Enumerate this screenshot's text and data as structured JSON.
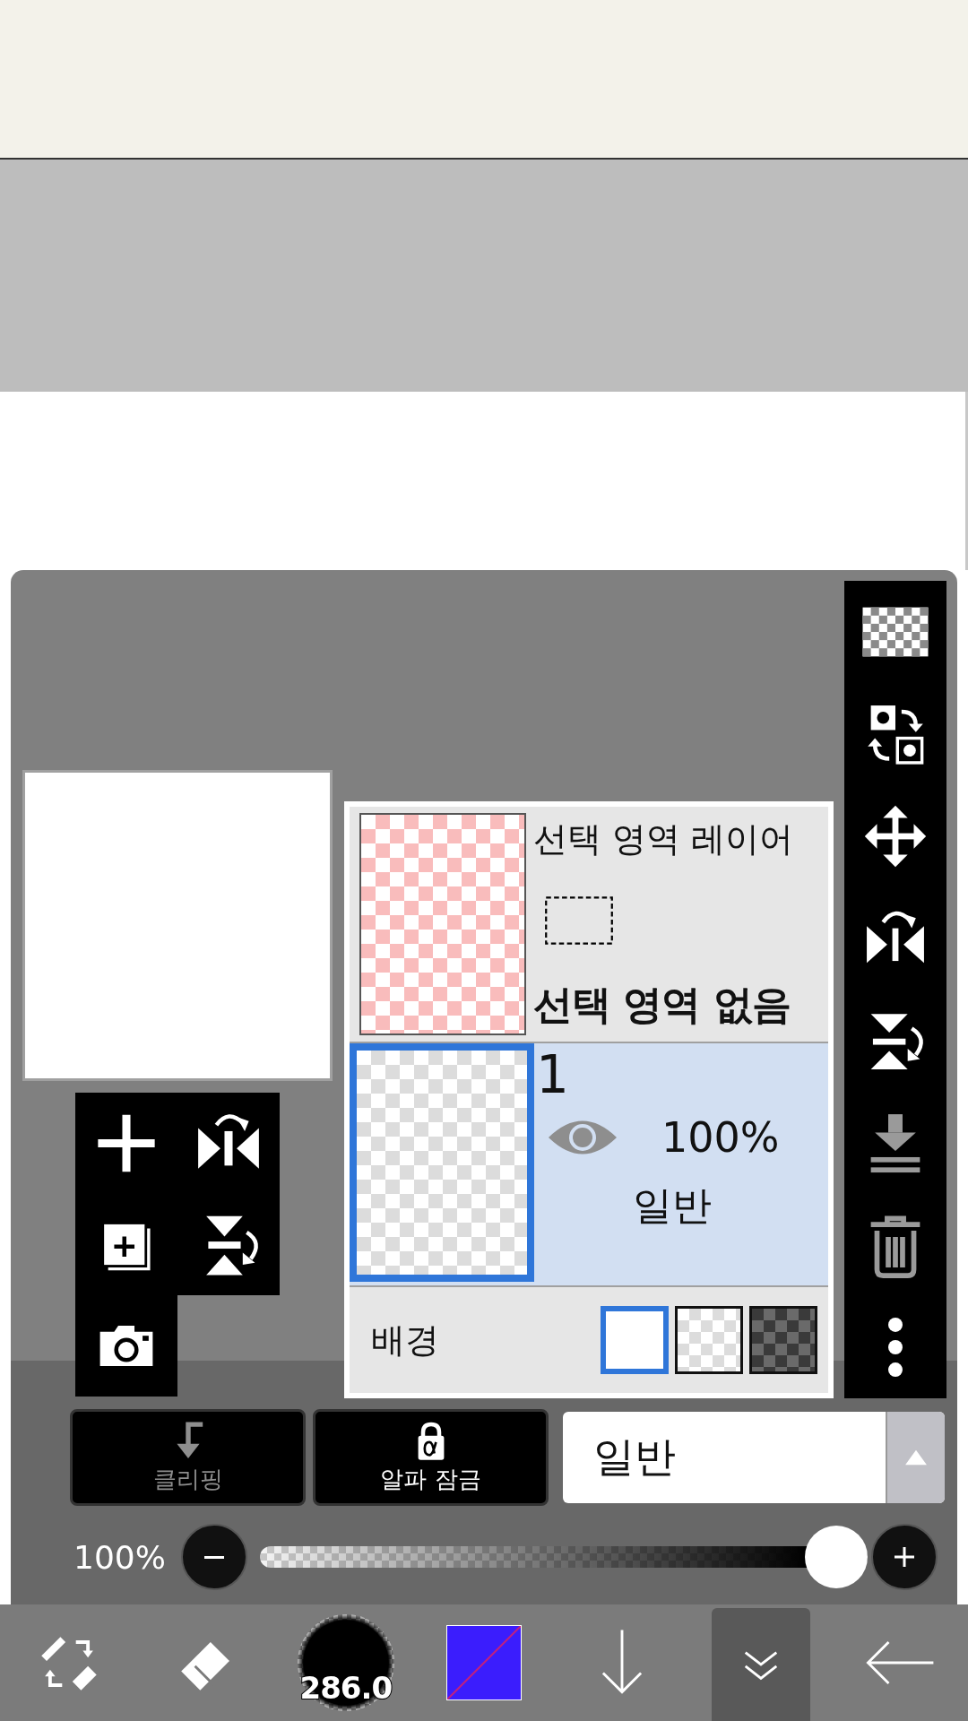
{
  "layers": [
    {
      "kind": "selection",
      "title": "선택 영역 레이어",
      "status": "선택 영역 없음",
      "selected": false
    },
    {
      "kind": "layer",
      "name": "1",
      "visible": true,
      "opacity": "100%",
      "blend": "일반",
      "selected": true
    }
  ],
  "background": {
    "label": "배경",
    "options": [
      {
        "kind": "white",
        "selected": true
      },
      {
        "kind": "checker",
        "selected": false
      },
      {
        "kind": "dark",
        "selected": false
      }
    ]
  },
  "layer_buttons": [
    {
      "kind": "clipping",
      "label": "클리핑",
      "disabled": true
    },
    {
      "kind": "alpha-lock",
      "label": "알파 잠금",
      "disabled": false
    }
  ],
  "blend_mode": {
    "value": "일반"
  },
  "opacity": {
    "reading": "100%",
    "level": 1
  },
  "bottom_bar": [
    {
      "kind": "swap",
      "selected": false
    },
    {
      "kind": "eraser",
      "selected": false
    },
    {
      "kind": "brush",
      "label": "286.0",
      "selected": false
    },
    {
      "kind": "color",
      "selected": false
    },
    {
      "kind": "down",
      "selected": false
    },
    {
      "kind": "collapse",
      "selected": true
    },
    {
      "kind": "back",
      "selected": false
    }
  ]
}
